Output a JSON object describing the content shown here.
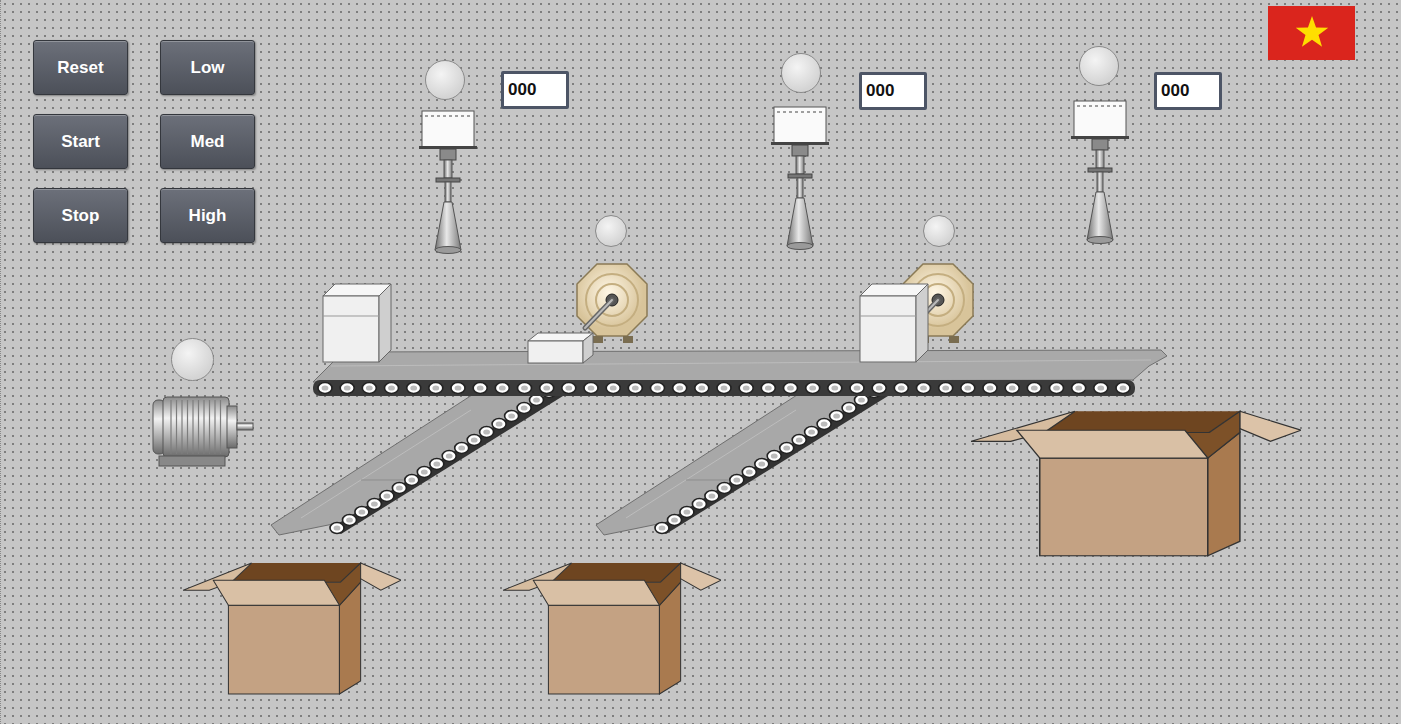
{
  "buttons": [
    {
      "label": "Reset"
    },
    {
      "label": "Low"
    },
    {
      "label": "Start"
    },
    {
      "label": "Med"
    },
    {
      "label": "Stop"
    },
    {
      "label": "High"
    }
  ],
  "sensors": [
    {
      "count": "000",
      "on": false
    },
    {
      "count": "000",
      "on": false
    },
    {
      "count": "000",
      "on": false
    }
  ],
  "pushers": [
    {
      "on": false
    },
    {
      "on": false
    }
  ],
  "motor": {
    "on": false
  },
  "products": [
    {
      "kind": "large"
    },
    {
      "kind": "small"
    },
    {
      "kind": "large"
    }
  ]
}
